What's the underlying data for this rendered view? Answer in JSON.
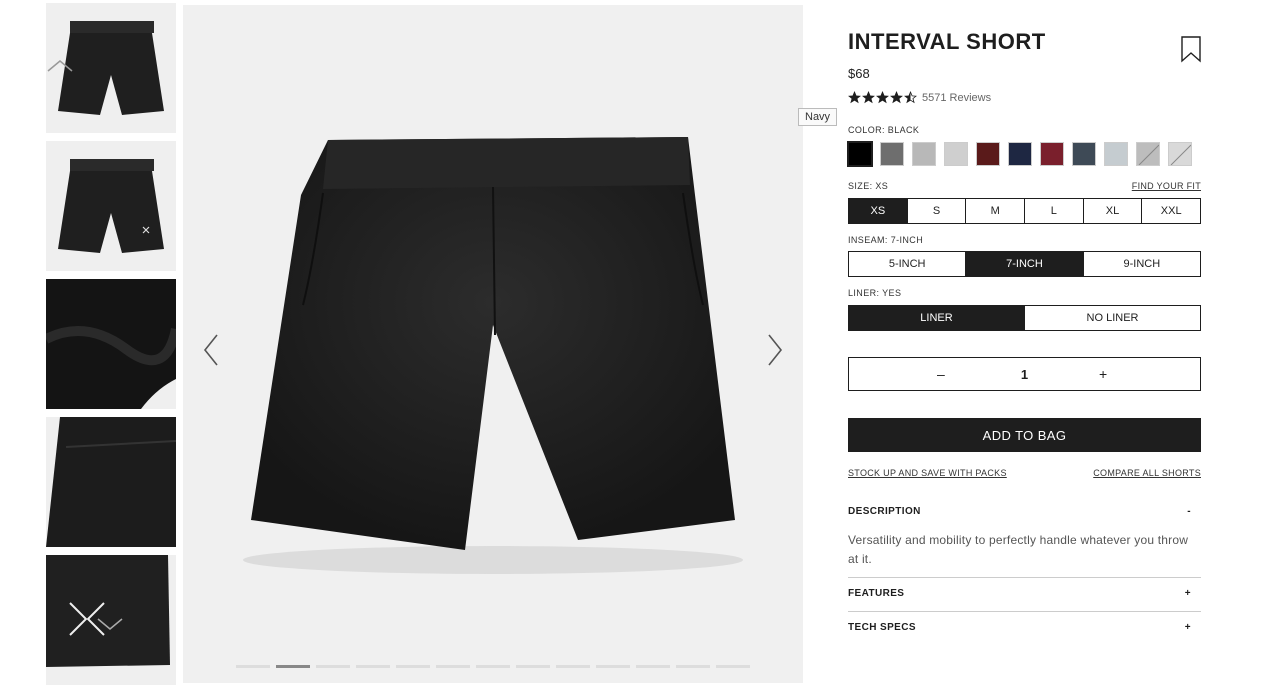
{
  "gallery": {
    "thumbnails": [
      {
        "alt": "front-view"
      },
      {
        "alt": "back-view"
      },
      {
        "alt": "fabric-detail"
      },
      {
        "alt": "pocket-detail"
      },
      {
        "alt": "logo-detail"
      }
    ],
    "dot_count": 13,
    "active_dot": 1
  },
  "tooltip": "Navy",
  "product": {
    "title": "INTERVAL SHORT",
    "price": "$68",
    "rating": 4.5,
    "reviews": "5571 Reviews"
  },
  "color": {
    "label": "COLOR: BLACK",
    "swatches": [
      {
        "name": "Black",
        "hex": "#000000",
        "selected": true
      },
      {
        "name": "Charcoal Camo",
        "hex": "#6e6e6e"
      },
      {
        "name": "Grey Camo",
        "hex": "#b8b8b8"
      },
      {
        "name": "Light Grey",
        "hex": "#cfcfcf"
      },
      {
        "name": "Oxblood",
        "hex": "#5a1a1a"
      },
      {
        "name": "Navy",
        "hex": "#1e2742"
      },
      {
        "name": "Red",
        "hex": "#7a1f2c"
      },
      {
        "name": "Slate",
        "hex": "#3e4a56"
      },
      {
        "name": "Ice",
        "hex": "#c5ccd0"
      },
      {
        "name": "Sold Out Grey",
        "hex": "#bdbdbd",
        "sold_out": true
      },
      {
        "name": "Sold Out Light",
        "hex": "#d9d9d9",
        "sold_out": true
      }
    ]
  },
  "size": {
    "label": "SIZE: XS",
    "fit_link": "FIND YOUR FIT",
    "options": [
      "XS",
      "S",
      "M",
      "L",
      "XL",
      "XXL"
    ],
    "selected": 0
  },
  "inseam": {
    "label": "INSEAM: 7-INCH",
    "options": [
      "5-INCH",
      "7-INCH",
      "9-INCH"
    ],
    "selected": 1
  },
  "liner": {
    "label": "LINER: YES",
    "options": [
      "LINER",
      "NO LINER"
    ],
    "selected": 0
  },
  "quantity": {
    "minus": "–",
    "value": "1",
    "plus": "+"
  },
  "add_to_bag": "ADD TO BAG",
  "links": {
    "packs": "STOCK UP AND SAVE WITH PACKS",
    "compare": "COMPARE ALL SHORTS"
  },
  "accordions": [
    {
      "title": "DESCRIPTION",
      "symbol": "-",
      "body": "Versatility and mobility to perfectly handle whatever you throw at it."
    },
    {
      "title": "FEATURES",
      "symbol": "+"
    },
    {
      "title": "TECH SPECS",
      "symbol": "+"
    }
  ],
  "colors": {
    "ink": "#1e1e1e",
    "image_bg": "#f0f0f0",
    "dot_active": "#888888",
    "dot_inactive": "#dddddd"
  }
}
